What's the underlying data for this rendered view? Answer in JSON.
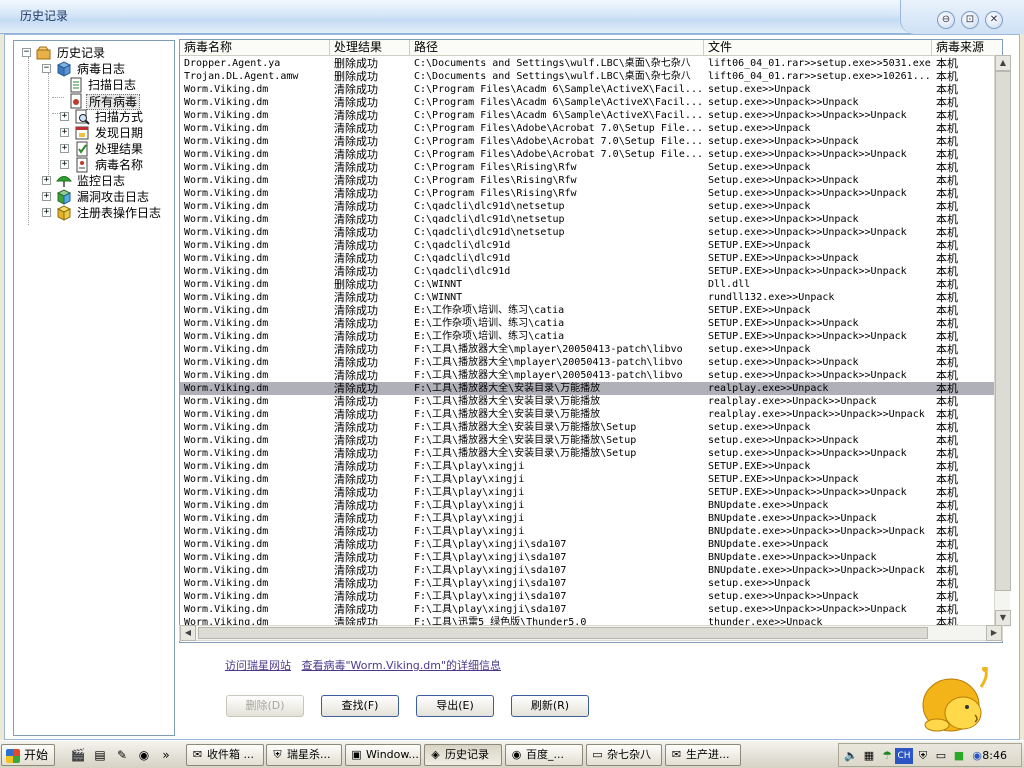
{
  "window": {
    "title": "历史记录",
    "minimize_glyph": "⊖",
    "restore_glyph": "⊡",
    "close_glyph": "✕"
  },
  "tree": {
    "root": "历史记录",
    "virus_log": "病毒日志",
    "scan_log": "扫描日志",
    "all_viruses": "所有病毒",
    "scan_method": "扫描方式",
    "found_date": "发现日期",
    "handle_result": "处理结果",
    "virus_name": "病毒名称",
    "monitor_log": "监控日志",
    "exploit_log": "漏洞攻击日志",
    "registry_log": "注册表操作日志"
  },
  "grid": {
    "columns": [
      "病毒名称",
      "处理结果",
      "路径",
      "文件",
      "病毒来源"
    ],
    "selected_row": 25,
    "rows": [
      [
        "Dropper.Agent.ya",
        "删除成功",
        "C:\\Documents and Settings\\wulf.LBC\\桌面\\杂七杂八",
        "lift06_04_01.rar>>setup.exe>>5031.exe",
        "本机"
      ],
      [
        "Trojan.DL.Agent.amw",
        "删除成功",
        "C:\\Documents and Settings\\wulf.LBC\\桌面\\杂七杂八",
        "lift06_04_01.rar>>setup.exe>>10261...",
        "本机"
      ],
      [
        "Worm.Viking.dm",
        "清除成功",
        "C:\\Program Files\\Acadm 6\\Sample\\ActiveX\\Facil...",
        "setup.exe>>Unpack",
        "本机"
      ],
      [
        "Worm.Viking.dm",
        "清除成功",
        "C:\\Program Files\\Acadm 6\\Sample\\ActiveX\\Facil...",
        "setup.exe>>Unpack>>Unpack",
        "本机"
      ],
      [
        "Worm.Viking.dm",
        "清除成功",
        "C:\\Program Files\\Acadm 6\\Sample\\ActiveX\\Facil...",
        "setup.exe>>Unpack>>Unpack>>Unpack",
        "本机"
      ],
      [
        "Worm.Viking.dm",
        "清除成功",
        "C:\\Program Files\\Adobe\\Acrobat 7.0\\Setup File...",
        "setup.exe>>Unpack",
        "本机"
      ],
      [
        "Worm.Viking.dm",
        "清除成功",
        "C:\\Program Files\\Adobe\\Acrobat 7.0\\Setup File...",
        "setup.exe>>Unpack>>Unpack",
        "本机"
      ],
      [
        "Worm.Viking.dm",
        "清除成功",
        "C:\\Program Files\\Adobe\\Acrobat 7.0\\Setup File...",
        "setup.exe>>Unpack>>Unpack>>Unpack",
        "本机"
      ],
      [
        "Worm.Viking.dm",
        "清除成功",
        "C:\\Program Files\\Rising\\Rfw",
        "Setup.exe>>Unpack",
        "本机"
      ],
      [
        "Worm.Viking.dm",
        "清除成功",
        "C:\\Program Files\\Rising\\Rfw",
        "Setup.exe>>Unpack>>Unpack",
        "本机"
      ],
      [
        "Worm.Viking.dm",
        "清除成功",
        "C:\\Program Files\\Rising\\Rfw",
        "Setup.exe>>Unpack>>Unpack>>Unpack",
        "本机"
      ],
      [
        "Worm.Viking.dm",
        "清除成功",
        "C:\\qadcli\\dlc91d\\netsetup",
        "setup.exe>>Unpack",
        "本机"
      ],
      [
        "Worm.Viking.dm",
        "清除成功",
        "C:\\qadcli\\dlc91d\\netsetup",
        "setup.exe>>Unpack>>Unpack",
        "本机"
      ],
      [
        "Worm.Viking.dm",
        "清除成功",
        "C:\\qadcli\\dlc91d\\netsetup",
        "setup.exe>>Unpack>>Unpack>>Unpack",
        "本机"
      ],
      [
        "Worm.Viking.dm",
        "清除成功",
        "C:\\qadcli\\dlc91d",
        "SETUP.EXE>>Unpack",
        "本机"
      ],
      [
        "Worm.Viking.dm",
        "清除成功",
        "C:\\qadcli\\dlc91d",
        "SETUP.EXE>>Unpack>>Unpack",
        "本机"
      ],
      [
        "Worm.Viking.dm",
        "清除成功",
        "C:\\qadcli\\dlc91d",
        "SETUP.EXE>>Unpack>>Unpack>>Unpack",
        "本机"
      ],
      [
        "Worm.Viking.dm",
        "删除成功",
        "C:\\WINNT",
        "Dll.dll",
        "本机"
      ],
      [
        "Worm.Viking.dm",
        "清除成功",
        "C:\\WINNT",
        "rundll132.exe>>Unpack",
        "本机"
      ],
      [
        "Worm.Viking.dm",
        "清除成功",
        "E:\\工作杂项\\培训、练习\\catia",
        "SETUP.EXE>>Unpack",
        "本机"
      ],
      [
        "Worm.Viking.dm",
        "清除成功",
        "E:\\工作杂项\\培训、练习\\catia",
        "SETUP.EXE>>Unpack>>Unpack",
        "本机"
      ],
      [
        "Worm.Viking.dm",
        "清除成功",
        "E:\\工作杂项\\培训、练习\\catia",
        "SETUP.EXE>>Unpack>>Unpack>>Unpack",
        "本机"
      ],
      [
        "Worm.Viking.dm",
        "清除成功",
        "F:\\工具\\播放器大全\\mplayer\\20050413-patch\\libvo",
        "setup.exe>>Unpack",
        "本机"
      ],
      [
        "Worm.Viking.dm",
        "清除成功",
        "F:\\工具\\播放器大全\\mplayer\\20050413-patch\\libvo",
        "setup.exe>>Unpack>>Unpack",
        "本机"
      ],
      [
        "Worm.Viking.dm",
        "清除成功",
        "F:\\工具\\播放器大全\\mplayer\\20050413-patch\\libvo",
        "setup.exe>>Unpack>>Unpack>>Unpack",
        "本机"
      ],
      [
        "Worm.Viking.dm",
        "清除成功",
        "F:\\工具\\播放器大全\\安装目录\\万能播放",
        "realplay.exe>>Unpack",
        "本机"
      ],
      [
        "Worm.Viking.dm",
        "清除成功",
        "F:\\工具\\播放器大全\\安装目录\\万能播放",
        "realplay.exe>>Unpack>>Unpack",
        "本机"
      ],
      [
        "Worm.Viking.dm",
        "清除成功",
        "F:\\工具\\播放器大全\\安装目录\\万能播放",
        "realplay.exe>>Unpack>>Unpack>>Unpack",
        "本机"
      ],
      [
        "Worm.Viking.dm",
        "清除成功",
        "F:\\工具\\播放器大全\\安装目录\\万能播放\\Setup",
        "setup.exe>>Unpack",
        "本机"
      ],
      [
        "Worm.Viking.dm",
        "清除成功",
        "F:\\工具\\播放器大全\\安装目录\\万能播放\\Setup",
        "setup.exe>>Unpack>>Unpack",
        "本机"
      ],
      [
        "Worm.Viking.dm",
        "清除成功",
        "F:\\工具\\播放器大全\\安装目录\\万能播放\\Setup",
        "setup.exe>>Unpack>>Unpack>>Unpack",
        "本机"
      ],
      [
        "Worm.Viking.dm",
        "清除成功",
        "F:\\工具\\play\\xingji",
        "SETUP.EXE>>Unpack",
        "本机"
      ],
      [
        "Worm.Viking.dm",
        "清除成功",
        "F:\\工具\\play\\xingji",
        "SETUP.EXE>>Unpack>>Unpack",
        "本机"
      ],
      [
        "Worm.Viking.dm",
        "清除成功",
        "F:\\工具\\play\\xingji",
        "SETUP.EXE>>Unpack>>Unpack>>Unpack",
        "本机"
      ],
      [
        "Worm.Viking.dm",
        "清除成功",
        "F:\\工具\\play\\xingji",
        "BNUpdate.exe>>Unpack",
        "本机"
      ],
      [
        "Worm.Viking.dm",
        "清除成功",
        "F:\\工具\\play\\xingji",
        "BNUpdate.exe>>Unpack>>Unpack",
        "本机"
      ],
      [
        "Worm.Viking.dm",
        "清除成功",
        "F:\\工具\\play\\xingji",
        "BNUpdate.exe>>Unpack>>Unpack>>Unpack",
        "本机"
      ],
      [
        "Worm.Viking.dm",
        "清除成功",
        "F:\\工具\\play\\xingji\\sda107",
        "BNUpdate.exe>>Unpack",
        "本机"
      ],
      [
        "Worm.Viking.dm",
        "清除成功",
        "F:\\工具\\play\\xingji\\sda107",
        "BNUpdate.exe>>Unpack>>Unpack",
        "本机"
      ],
      [
        "Worm.Viking.dm",
        "清除成功",
        "F:\\工具\\play\\xingji\\sda107",
        "BNUpdate.exe>>Unpack>>Unpack>>Unpack",
        "本机"
      ],
      [
        "Worm.Viking.dm",
        "清除成功",
        "F:\\工具\\play\\xingji\\sda107",
        "setup.exe>>Unpack",
        "本机"
      ],
      [
        "Worm.Viking.dm",
        "清除成功",
        "F:\\工具\\play\\xingji\\sda107",
        "setup.exe>>Unpack>>Unpack",
        "本机"
      ],
      [
        "Worm.Viking.dm",
        "清除成功",
        "F:\\工具\\play\\xingji\\sda107",
        "setup.exe>>Unpack>>Unpack>>Unpack",
        "本机"
      ],
      [
        "Worm.Viking.dm",
        "清除成功",
        "F:\\工具\\迅雷5 绿色版\\Thunder5.0",
        "thunder.exe>>Unpack",
        "本机"
      ]
    ]
  },
  "bottom": {
    "link_visit": "访问瑞星网站",
    "link_view": "查看病毒\"Worm.Viking.dm\"的详细信息",
    "btn_delete": "删除(D)",
    "btn_find": "查找(F)",
    "btn_export": "导出(E)",
    "btn_refresh": "刷新(R)"
  },
  "taskbar": {
    "start": "开始",
    "tasks": [
      "收件箱 ...",
      "瑞星杀...",
      "Window...",
      "历史记录",
      "百度_...",
      "杂七杂八",
      "生产进..."
    ],
    "tray_lang": "CH",
    "clock": "8:46"
  },
  "icons": {
    "tree_root": "folder-shield-icon",
    "virus_log": "book-icon",
    "scan_log": "log-page-icon",
    "all_viruses": "bug-page-icon",
    "scan_method": "magnifier-icon",
    "found_date": "calendar-icon",
    "handle_result": "document-icon",
    "virus_name": "virus-list-icon",
    "monitor_log": "umbrella-icon",
    "exploit_log": "shield-cube-icon",
    "registry_log": "registry-cube-icon",
    "mascot": "lion-mascot-icon"
  },
  "colors": {
    "link": "#4b3a8c",
    "selected_row": "#b0b0b8",
    "title_text": "#223a66"
  }
}
